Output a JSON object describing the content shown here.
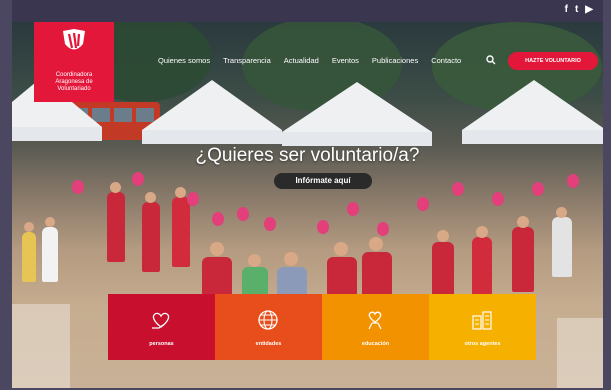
{
  "social": {
    "facebook": "f",
    "twitter": "t",
    "youtube": "▶"
  },
  "logo": {
    "line1": "Coordinadora",
    "line2": "Aragonesa de",
    "line3": "Voluntariado"
  },
  "nav": {
    "items": [
      "Quienes somos",
      "Transparencia",
      "Actualidad",
      "Eventos",
      "Publicaciones",
      "Contacto"
    ]
  },
  "cta": {
    "label": "HAZTE VOLUNTARIO"
  },
  "hero": {
    "title": "¿Quieres ser voluntario/a?",
    "button": "Infórmate aquí"
  },
  "tiles": [
    {
      "label": "personas",
      "color": "#c8102e",
      "icon": "heart-hand-icon"
    },
    {
      "label": "entidades",
      "color": "#e84e1b",
      "icon": "globe-icon"
    },
    {
      "label": "educación",
      "color": "#f39200",
      "icon": "handshake-icon"
    },
    {
      "label": "otros agentes",
      "color": "#f6b000",
      "icon": "buildings-icon"
    }
  ]
}
